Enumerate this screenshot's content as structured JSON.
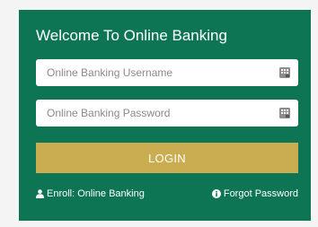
{
  "login_panel": {
    "title": "Welcome To Online Banking",
    "username": {
      "placeholder": "Online Banking Username",
      "value": "",
      "icon": "virtual-keyboard-icon"
    },
    "password": {
      "placeholder": "Online Banking Password",
      "value": "",
      "icon": "virtual-keyboard-icon"
    },
    "login_label": "LOGIN",
    "enroll": {
      "label": "Enroll: Online Banking",
      "icon": "user-icon"
    },
    "forgot": {
      "label": "Forgot Password",
      "icon": "info-circle-icon"
    },
    "colors": {
      "panel_bg": "#0e7554",
      "button_bg": "#c9ad50",
      "text": "#ffffff"
    }
  }
}
